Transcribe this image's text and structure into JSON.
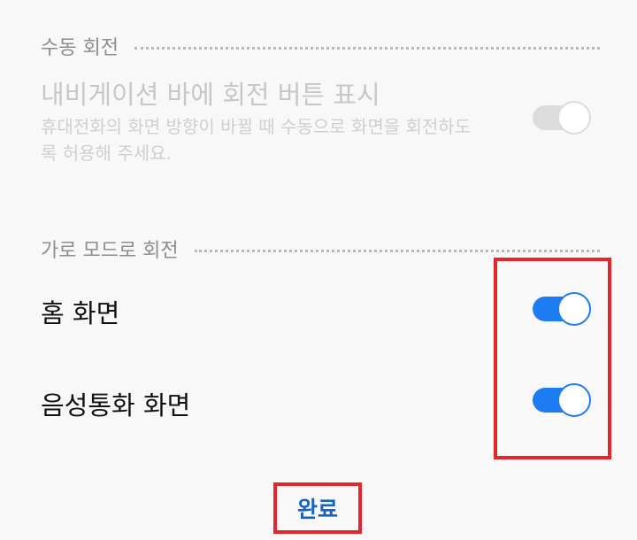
{
  "sections": {
    "manual_rotation": {
      "header": "수동 회전",
      "item": {
        "title": "내비게이션 바에 회전 버튼 표시",
        "description": "휴대전화의 화면 방향이 바뀔 때 수동으로 화면을 회전하도록 허용해 주세요.",
        "enabled": false,
        "toggle_state": "off"
      }
    },
    "landscape_rotation": {
      "header": "가로 모드로 회전",
      "items": [
        {
          "title": "홈 화면",
          "toggle_state": "on"
        },
        {
          "title": "음성통화 화면",
          "toggle_state": "on"
        }
      ]
    }
  },
  "footer": {
    "done_label": "완료"
  },
  "colors": {
    "accent": "#1e7cf2",
    "done_text": "#1565c0",
    "highlight": "#e3262e",
    "disabled_text": "#c7c7c7"
  }
}
